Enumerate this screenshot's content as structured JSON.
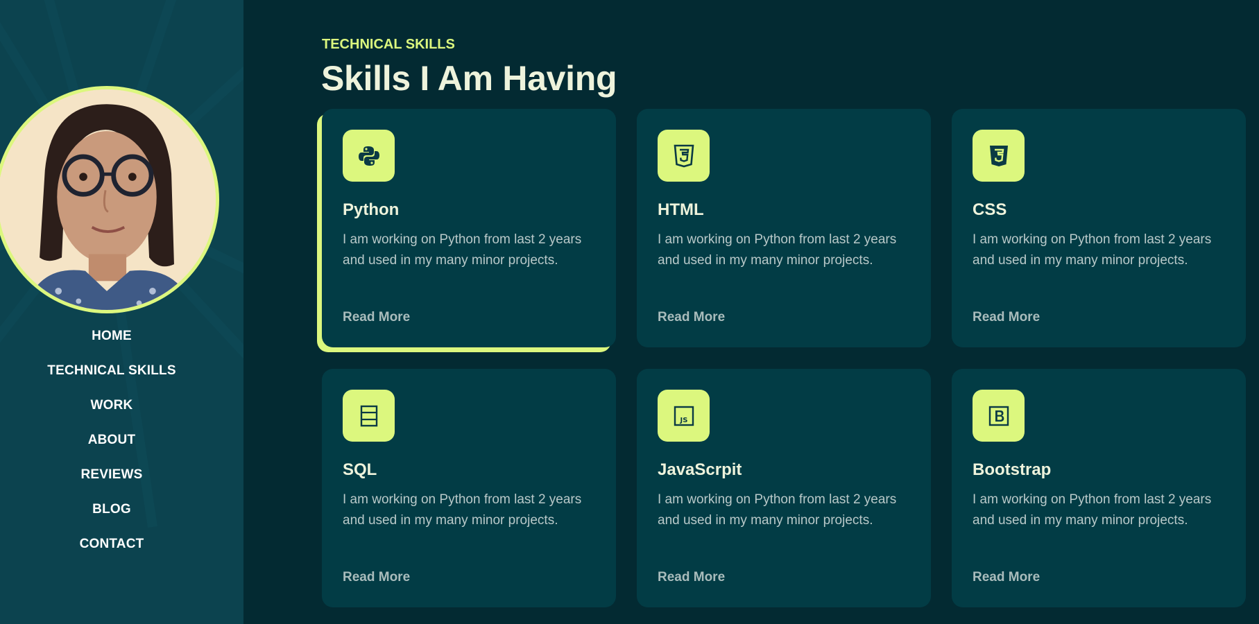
{
  "sidebar": {
    "nav": [
      {
        "label": "HOME"
      },
      {
        "label": "TECHNICAL SKILLS"
      },
      {
        "label": "WORK"
      },
      {
        "label": "ABOUT"
      },
      {
        "label": "REVIEWS"
      },
      {
        "label": "BLOG"
      },
      {
        "label": "CONTACT"
      }
    ]
  },
  "section": {
    "eyebrow": "TECHNICAL SKILLS",
    "title": "Skills I Am Having"
  },
  "skills": [
    {
      "title": "Python",
      "icon": "python-icon",
      "desc": "I am working on Python from last 2 years and used in my many minor projects.",
      "link": "Read More"
    },
    {
      "title": "HTML",
      "icon": "html5-icon",
      "desc": "I am working on Python from last 2 years and used in my many minor projects.",
      "link": "Read More"
    },
    {
      "title": "CSS",
      "icon": "css3-icon",
      "desc": "I am working on Python from last 2 years and used in my many minor projects.",
      "link": "Read More"
    },
    {
      "title": "SQL",
      "icon": "database-icon",
      "desc": "I am working on Python from last 2 years and used in my many minor projects.",
      "link": "Read More"
    },
    {
      "title": "JavaScrpit",
      "icon": "javascript-icon",
      "desc": "I am working on Python from last 2 years and used in my many minor projects.",
      "link": "Read More"
    },
    {
      "title": "Bootstrap",
      "icon": "bootstrap-icon",
      "desc": "I am working on Python from last 2 years and used in my many minor projects.",
      "link": "Read More"
    }
  ],
  "colors": {
    "accent": "#dcf77e",
    "background": "#032a32",
    "sidebar": "#0c434f",
    "card": "#023c45"
  }
}
